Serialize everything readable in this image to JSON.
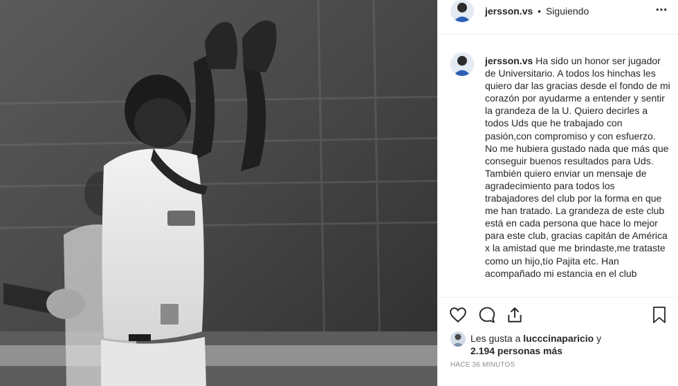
{
  "post": {
    "photo_alt": "photo"
  },
  "header": {
    "username": "jersson.vs",
    "separator": "•",
    "follow_status": "Siguiendo",
    "more_symbol": "···"
  },
  "caption": {
    "username": "jersson.vs",
    "text": "Ha sido un honor ser jugador de Universitario. A todos los hinchas les quiero dar las gracias desde el fondo de mi corazón por ayudarme a entender y sentir la grandeza de la U. Quiero decirles a todos Uds que he trabajado con pasión,con compromiso y con esfuerzo. No me hubiera gustado nada que más que conseguir buenos resultados para Uds. También quiero enviar un mensaje de agradecimiento para todos los trabajadores del club por la forma en que me han tratado. La grandeza de este club está en cada persona que hace lo mejor para este club, gracias capitán de América x la amistad que me brindaste,me trataste como un hijo,tío Pajita etc. Han acompañado mi estancia en el club"
  },
  "actions": {
    "like_icon": "heart-icon",
    "comment_icon": "comment-bubble-icon",
    "share_icon": "share-upload-icon",
    "save_icon": "bookmark-icon"
  },
  "likes": {
    "prefix": "Les gusta a",
    "liker": "lucccinaparicio",
    "conj": "y",
    "count_text": "2.194 personas más"
  },
  "timestamp": "HACE 36 MINUTOS"
}
